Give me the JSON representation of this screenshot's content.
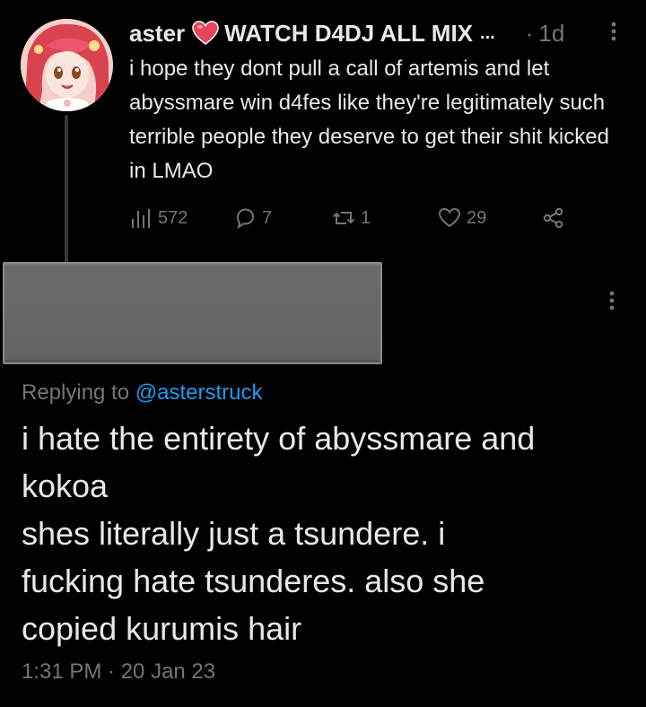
{
  "parent_tweet": {
    "display_name": "aster",
    "heart_emoji": "heart-emoji",
    "community_name": "WATCH D4DJ ALL MIX",
    "truncation": "...",
    "separator": "·",
    "age": "1d",
    "text": "i hope they dont pull a call of artemis and let abyssmare win d4fes like they're legitimately such terrible people they deserve to get their shit kicked in LMAO",
    "actions": {
      "views": "572",
      "replies": "7",
      "retweets": "1",
      "likes": "29"
    }
  },
  "main_tweet": {
    "replying_prefix": "Replying to",
    "replying_handle": "@asterstruck",
    "text_lines": [
      "i hate the entirety of abyssmare and",
      "kokoa",
      "shes literally just a tsundere. i",
      "fucking hate tsunderes. also she",
      "copied kurumis hair"
    ],
    "timestamp": "1:31 PM · 20 Jan 23"
  },
  "colors": {
    "background": "#000000",
    "text_primary": "#e7e9ea",
    "text_secondary": "#71767b",
    "link": "#1d9bf0",
    "heart": "#e8445a",
    "redaction": "#666666"
  }
}
